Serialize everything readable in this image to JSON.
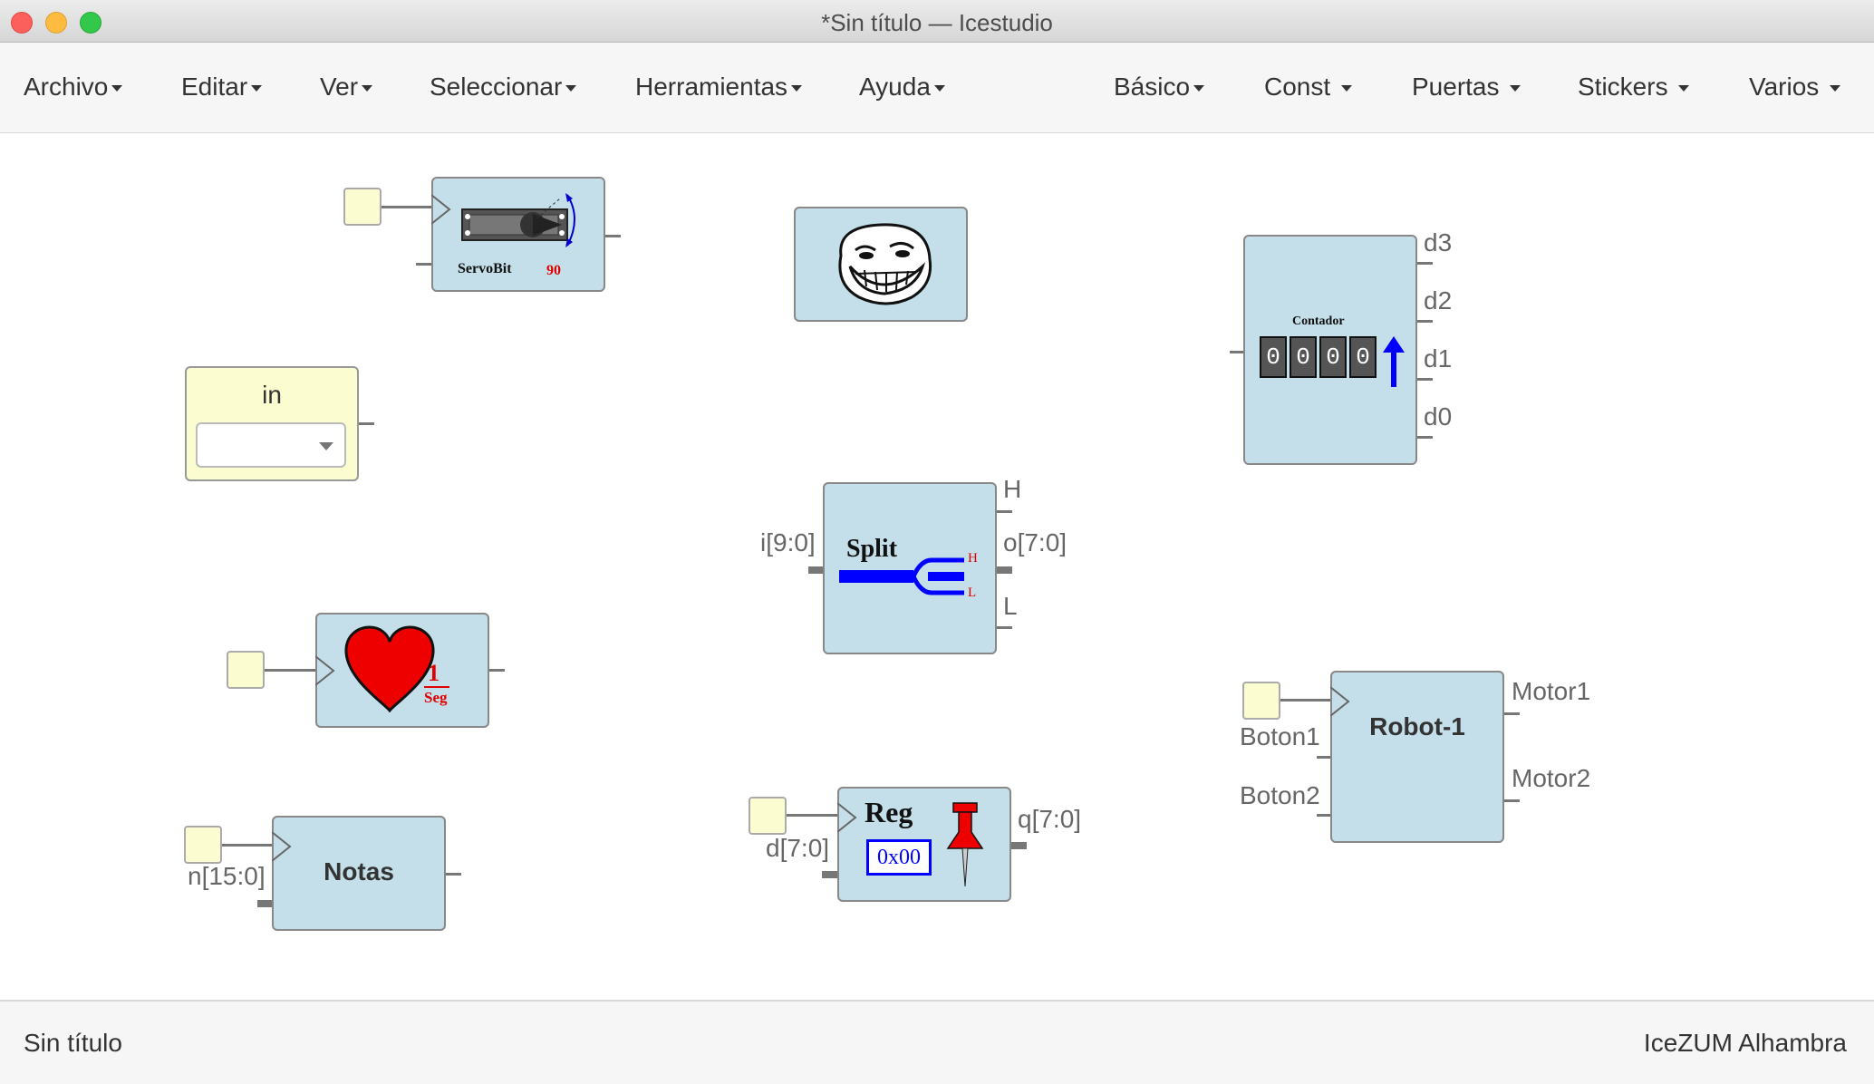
{
  "window": {
    "title": "*Sin título — Icestudio"
  },
  "menu_left": [
    "Archivo",
    "Editar",
    "Ver",
    "Seleccionar",
    "Herramientas",
    "Ayuda"
  ],
  "menu_right": [
    "Básico",
    "Const",
    "Puertas",
    "Stickers",
    "Varios"
  ],
  "blocks": {
    "servobit": {
      "name": "ServoBit",
      "value": "90"
    },
    "input": {
      "label": "in",
      "selected": ""
    },
    "split": {
      "title": "Split",
      "in_port": "i[9:0]",
      "out_h": "H",
      "out_bus": "o[7:0]",
      "out_l": "L",
      "icon_h": "H",
      "icon_l": "L"
    },
    "contador": {
      "title": "Contador",
      "digits": [
        "0",
        "0",
        "0",
        "0"
      ],
      "outputs": [
        "d3",
        "d2",
        "d1",
        "d0"
      ]
    },
    "heart": {
      "num": "1",
      "unit": "Seg"
    },
    "robot": {
      "title": "Robot-1",
      "inputs": [
        "Boton1",
        "Boton2"
      ],
      "outputs": [
        "Motor1",
        "Motor2"
      ]
    },
    "notas": {
      "title": "Notas",
      "in_port": "n[15:0]"
    },
    "reg": {
      "title": "Reg",
      "init": "0x00",
      "in_port": "d[7:0]",
      "out_port": "q[7:0]"
    }
  },
  "status": {
    "left": "Sin título",
    "right": "IceZUM Alhambra"
  },
  "colors": {
    "block_fill": "#c4dfe9",
    "io_fill": "#fbfcd0",
    "accent_red": "#e00000",
    "accent_blue": "#0000ff"
  }
}
